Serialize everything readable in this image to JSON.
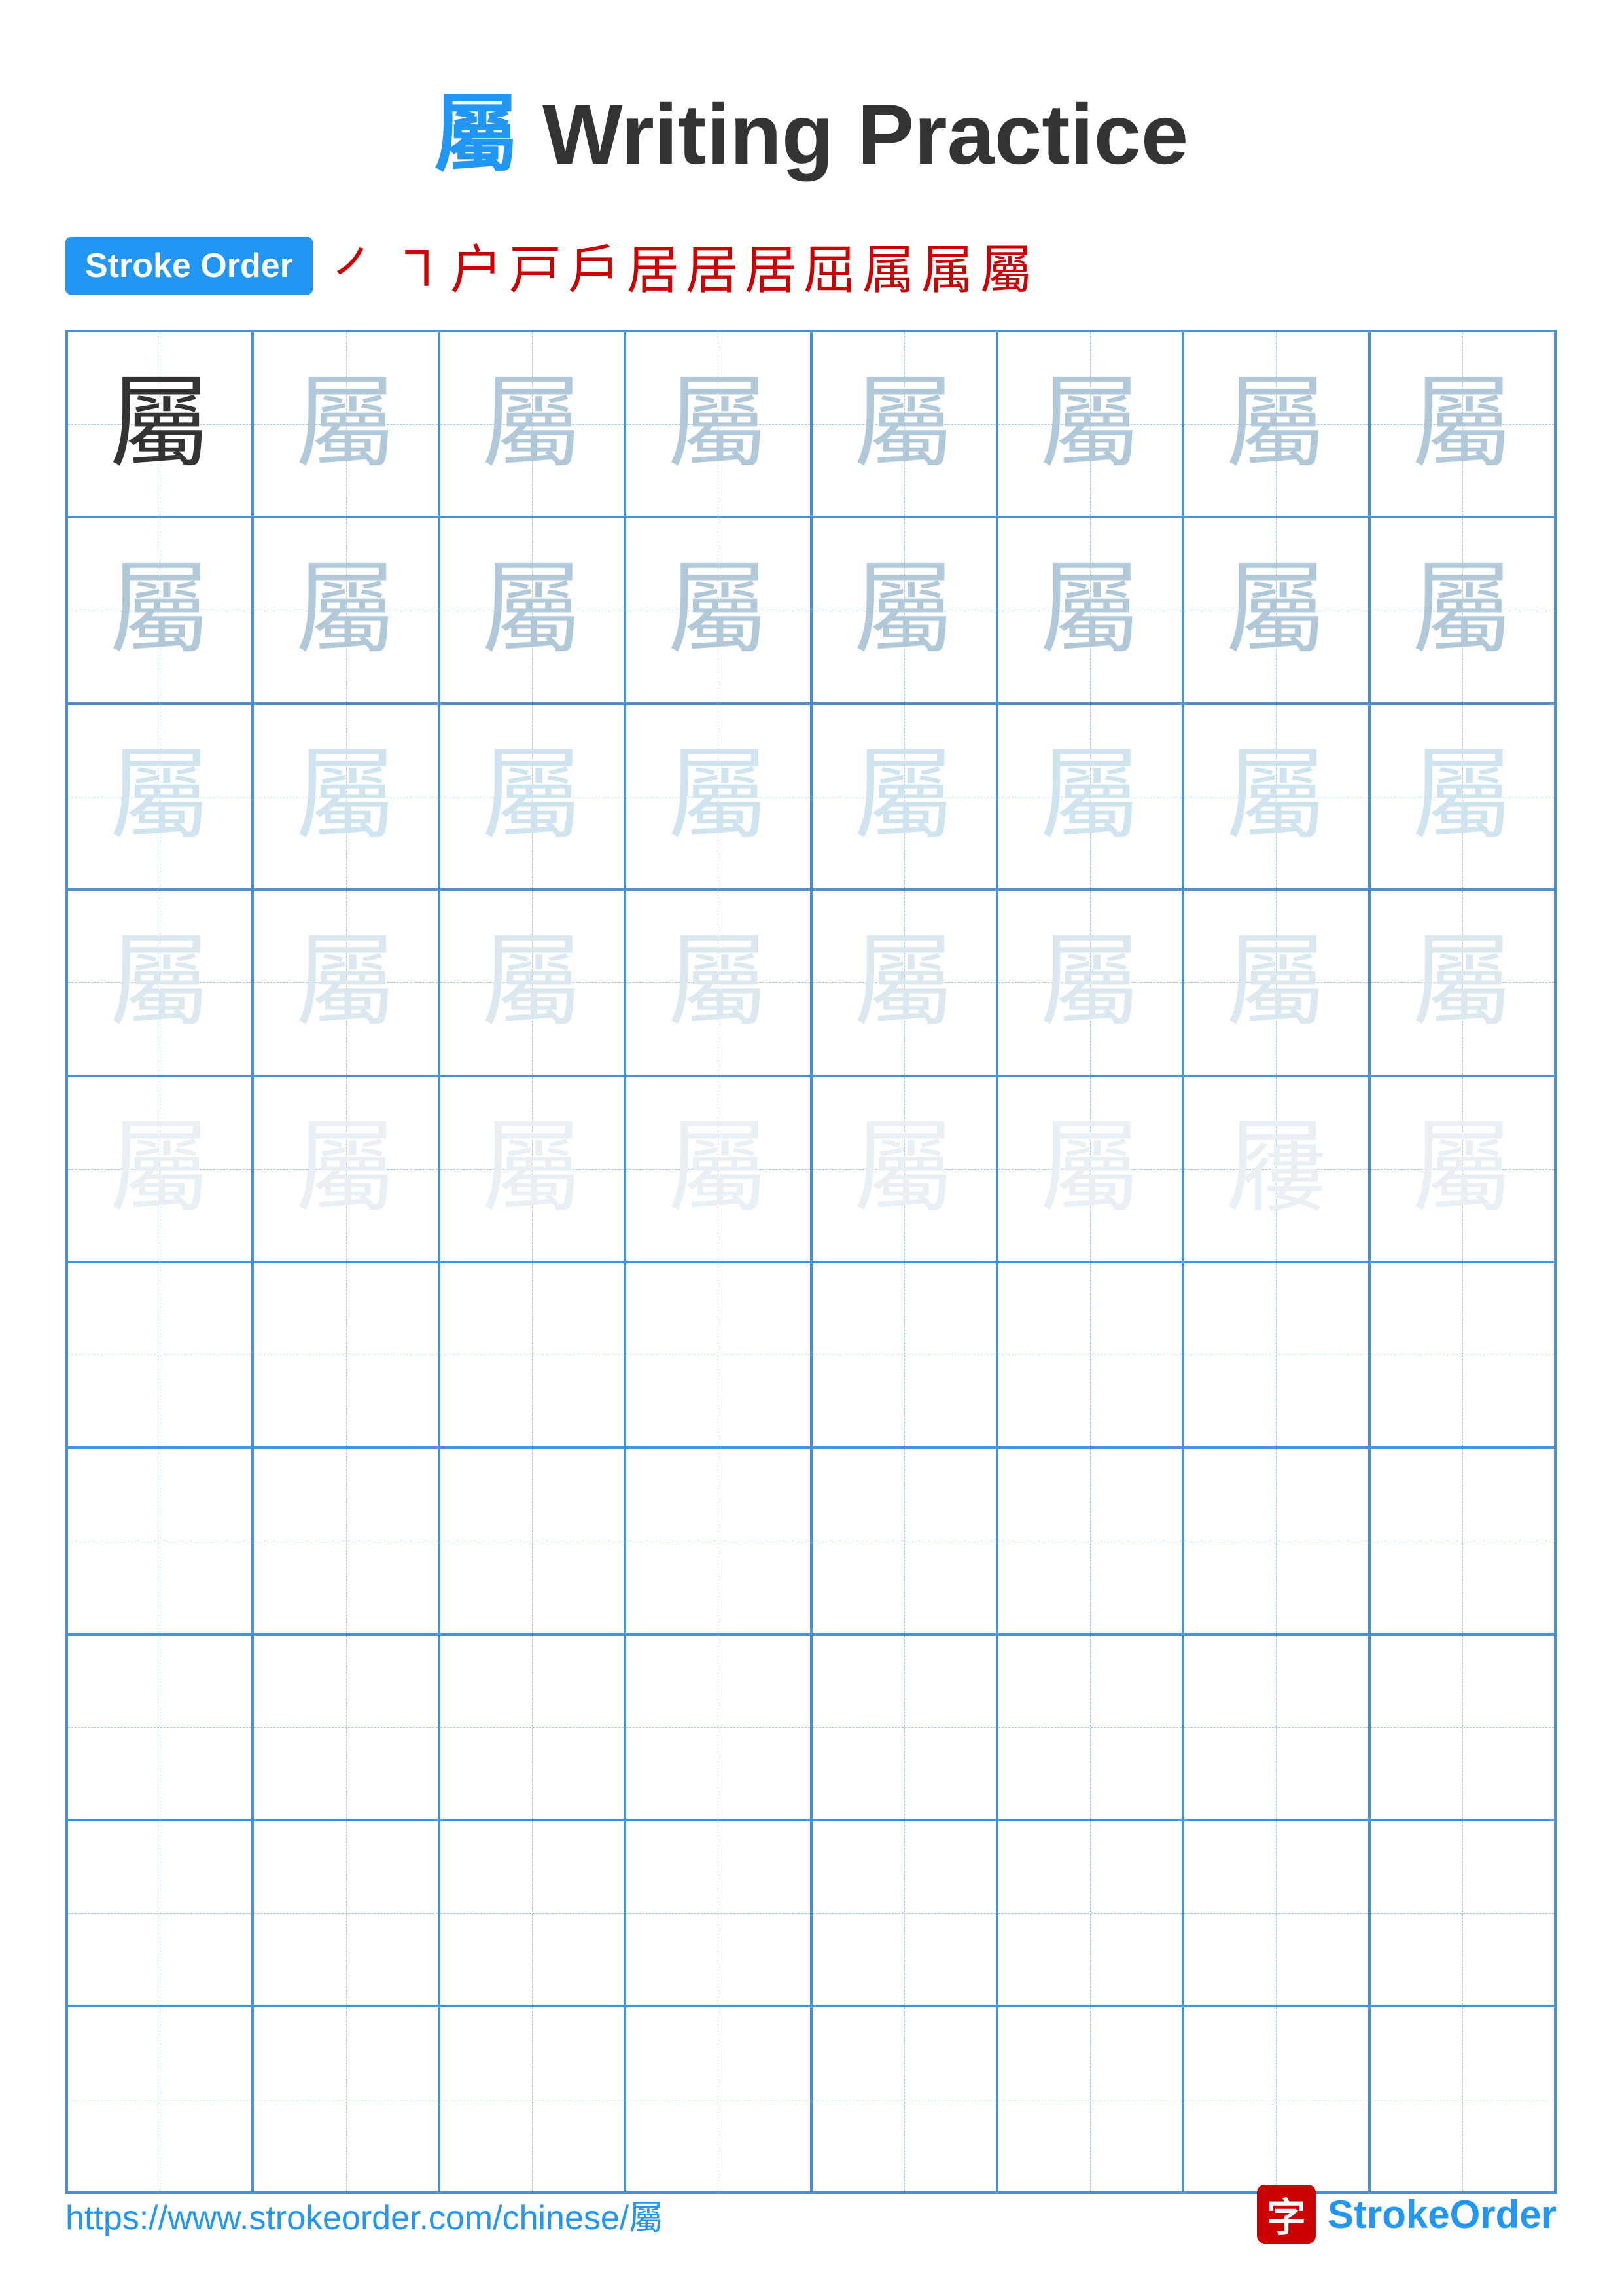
{
  "title": {
    "char": "屬",
    "text": " Writing Practice"
  },
  "stroke_order": {
    "badge_label": "Stroke Order",
    "strokes": [
      "㇒",
      "㇕",
      "户",
      "戸",
      "戶",
      "居",
      "居",
      "居",
      "屈",
      "属",
      "属",
      "屬"
    ]
  },
  "grid": {
    "cols": 8,
    "rows": 10,
    "char": "屬",
    "practice_rows": 5,
    "empty_rows": 5,
    "shading": [
      "dark",
      "medium",
      "medium",
      "light",
      "lighter",
      "lightest"
    ]
  },
  "footer": {
    "url": "https://www.strokeorder.com/chinese/屬",
    "brand_char": "字",
    "brand_name": "StrokeOrder"
  }
}
